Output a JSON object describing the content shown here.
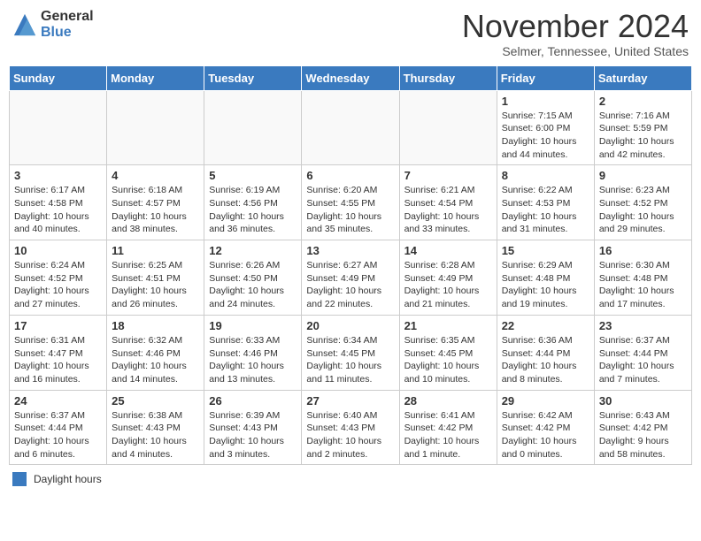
{
  "header": {
    "logo_general": "General",
    "logo_blue": "Blue",
    "month_title": "November 2024",
    "location": "Selmer, Tennessee, United States"
  },
  "footer": {
    "legend_label": "Daylight hours"
  },
  "weekdays": [
    "Sunday",
    "Monday",
    "Tuesday",
    "Wednesday",
    "Thursday",
    "Friday",
    "Saturday"
  ],
  "weeks": [
    [
      {
        "day": "",
        "info": ""
      },
      {
        "day": "",
        "info": ""
      },
      {
        "day": "",
        "info": ""
      },
      {
        "day": "",
        "info": ""
      },
      {
        "day": "",
        "info": ""
      },
      {
        "day": "1",
        "info": "Sunrise: 7:15 AM\nSunset: 6:00 PM\nDaylight: 10 hours and 44 minutes."
      },
      {
        "day": "2",
        "info": "Sunrise: 7:16 AM\nSunset: 5:59 PM\nDaylight: 10 hours and 42 minutes."
      }
    ],
    [
      {
        "day": "3",
        "info": "Sunrise: 6:17 AM\nSunset: 4:58 PM\nDaylight: 10 hours and 40 minutes."
      },
      {
        "day": "4",
        "info": "Sunrise: 6:18 AM\nSunset: 4:57 PM\nDaylight: 10 hours and 38 minutes."
      },
      {
        "day": "5",
        "info": "Sunrise: 6:19 AM\nSunset: 4:56 PM\nDaylight: 10 hours and 36 minutes."
      },
      {
        "day": "6",
        "info": "Sunrise: 6:20 AM\nSunset: 4:55 PM\nDaylight: 10 hours and 35 minutes."
      },
      {
        "day": "7",
        "info": "Sunrise: 6:21 AM\nSunset: 4:54 PM\nDaylight: 10 hours and 33 minutes."
      },
      {
        "day": "8",
        "info": "Sunrise: 6:22 AM\nSunset: 4:53 PM\nDaylight: 10 hours and 31 minutes."
      },
      {
        "day": "9",
        "info": "Sunrise: 6:23 AM\nSunset: 4:52 PM\nDaylight: 10 hours and 29 minutes."
      }
    ],
    [
      {
        "day": "10",
        "info": "Sunrise: 6:24 AM\nSunset: 4:52 PM\nDaylight: 10 hours and 27 minutes."
      },
      {
        "day": "11",
        "info": "Sunrise: 6:25 AM\nSunset: 4:51 PM\nDaylight: 10 hours and 26 minutes."
      },
      {
        "day": "12",
        "info": "Sunrise: 6:26 AM\nSunset: 4:50 PM\nDaylight: 10 hours and 24 minutes."
      },
      {
        "day": "13",
        "info": "Sunrise: 6:27 AM\nSunset: 4:49 PM\nDaylight: 10 hours and 22 minutes."
      },
      {
        "day": "14",
        "info": "Sunrise: 6:28 AM\nSunset: 4:49 PM\nDaylight: 10 hours and 21 minutes."
      },
      {
        "day": "15",
        "info": "Sunrise: 6:29 AM\nSunset: 4:48 PM\nDaylight: 10 hours and 19 minutes."
      },
      {
        "day": "16",
        "info": "Sunrise: 6:30 AM\nSunset: 4:48 PM\nDaylight: 10 hours and 17 minutes."
      }
    ],
    [
      {
        "day": "17",
        "info": "Sunrise: 6:31 AM\nSunset: 4:47 PM\nDaylight: 10 hours and 16 minutes."
      },
      {
        "day": "18",
        "info": "Sunrise: 6:32 AM\nSunset: 4:46 PM\nDaylight: 10 hours and 14 minutes."
      },
      {
        "day": "19",
        "info": "Sunrise: 6:33 AM\nSunset: 4:46 PM\nDaylight: 10 hours and 13 minutes."
      },
      {
        "day": "20",
        "info": "Sunrise: 6:34 AM\nSunset: 4:45 PM\nDaylight: 10 hours and 11 minutes."
      },
      {
        "day": "21",
        "info": "Sunrise: 6:35 AM\nSunset: 4:45 PM\nDaylight: 10 hours and 10 minutes."
      },
      {
        "day": "22",
        "info": "Sunrise: 6:36 AM\nSunset: 4:44 PM\nDaylight: 10 hours and 8 minutes."
      },
      {
        "day": "23",
        "info": "Sunrise: 6:37 AM\nSunset: 4:44 PM\nDaylight: 10 hours and 7 minutes."
      }
    ],
    [
      {
        "day": "24",
        "info": "Sunrise: 6:37 AM\nSunset: 4:44 PM\nDaylight: 10 hours and 6 minutes."
      },
      {
        "day": "25",
        "info": "Sunrise: 6:38 AM\nSunset: 4:43 PM\nDaylight: 10 hours and 4 minutes."
      },
      {
        "day": "26",
        "info": "Sunrise: 6:39 AM\nSunset: 4:43 PM\nDaylight: 10 hours and 3 minutes."
      },
      {
        "day": "27",
        "info": "Sunrise: 6:40 AM\nSunset: 4:43 PM\nDaylight: 10 hours and 2 minutes."
      },
      {
        "day": "28",
        "info": "Sunrise: 6:41 AM\nSunset: 4:42 PM\nDaylight: 10 hours and 1 minute."
      },
      {
        "day": "29",
        "info": "Sunrise: 6:42 AM\nSunset: 4:42 PM\nDaylight: 10 hours and 0 minutes."
      },
      {
        "day": "30",
        "info": "Sunrise: 6:43 AM\nSunset: 4:42 PM\nDaylight: 9 hours and 58 minutes."
      }
    ]
  ]
}
